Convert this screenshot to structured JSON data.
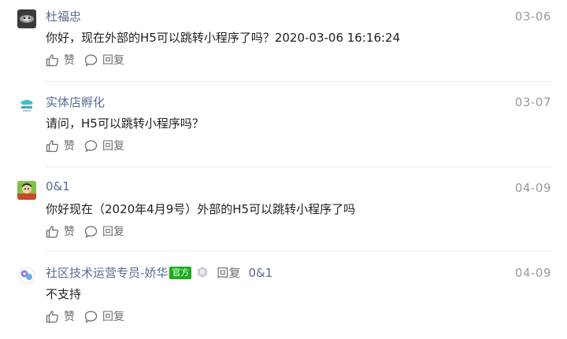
{
  "comments": [
    {
      "author": "杜福忠",
      "date": "03-06",
      "text": "你好，现在外部的H5可以跳转小程序了吗？2020-03-06 16:16:24",
      "like_label": "赞",
      "reply_label": "回复"
    },
    {
      "author": "实体店孵化",
      "date": "03-07",
      "text": "请问，H5可以跳转小程序吗？",
      "like_label": "赞",
      "reply_label": "回复"
    },
    {
      "author": "0&1",
      "date": "04-09",
      "text": "你好现在（2020年4月9号）外部的H5可以跳转小程序了吗",
      "like_label": "赞",
      "reply_label": "回复"
    },
    {
      "author": "社区技术运营专员-娇华",
      "badge": "官方",
      "reply_tag": "回复",
      "reply_to": "0&1",
      "date": "04-09",
      "text": "不支持",
      "like_label": "赞",
      "reply_label": "回复"
    }
  ],
  "icons": {
    "like": "thumbs-up-icon",
    "reply": "speech-bubble-icon",
    "medal": "medal-icon"
  },
  "colors": {
    "author": "#576b95",
    "date": "#9a9a9a",
    "badge": "#1aad19"
  }
}
